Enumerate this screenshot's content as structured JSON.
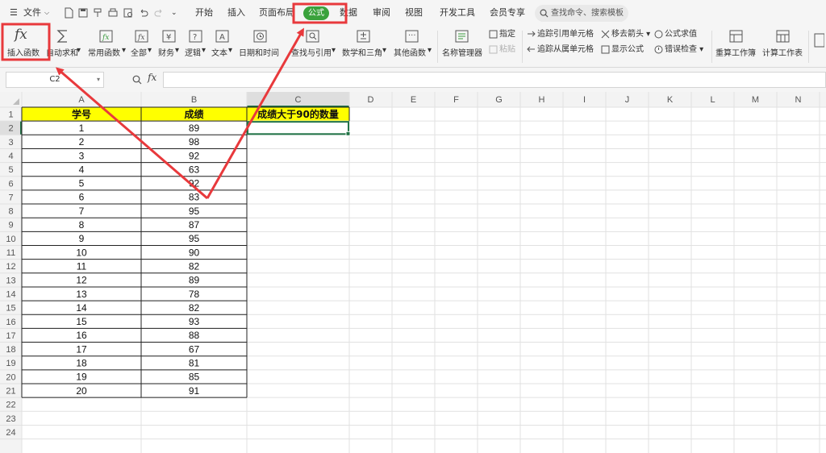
{
  "menu": {
    "file_label": "文件",
    "tabs": [
      "开始",
      "插入",
      "页面布局",
      "公式",
      "数据",
      "审阅",
      "视图",
      "开发工具",
      "会员专享"
    ],
    "active_tab": "公式",
    "search_placeholder": "查找命令、搜索模板"
  },
  "ribbon": {
    "insert_function": "插入函数",
    "autosum": "自动求和",
    "common_functions": "常用函数",
    "all": "全部",
    "financial": "财务",
    "logical": "逻辑",
    "text": "文本",
    "datetime": "日期和时间",
    "lookup": "查找与引用",
    "math": "数学和三角",
    "other": "其他函数",
    "name_manager": "名称管理器",
    "define": "指定",
    "paste": "粘贴",
    "trace_precedents": "追踪引用单元格",
    "trace_dependents": "追踪从属单元格",
    "remove_arrows": "移去箭头",
    "show_formulas": "显示公式",
    "evaluate_formula": "公式求值",
    "error_check": "错误检查",
    "recalc_workbook": "重算工作簿",
    "calc_sheet": "计算工作表",
    "fx_glyph": "fx"
  },
  "formula_bar": {
    "name_box": "C2",
    "fx_label": "fx",
    "formula": ""
  },
  "sheet": {
    "columns": [
      "A",
      "B",
      "C",
      "D",
      "E",
      "F",
      "G",
      "H",
      "I",
      "J",
      "K",
      "L",
      "M",
      "N"
    ],
    "row_numbers": [
      "1",
      "2",
      "3",
      "4",
      "5",
      "6",
      "7",
      "8",
      "9",
      "10",
      "11",
      "12",
      "13",
      "14",
      "15",
      "16",
      "17",
      "18",
      "19",
      "20",
      "21",
      "22",
      "23",
      "24"
    ],
    "headers": [
      "学号",
      "成绩",
      "成绩大于90的数量"
    ],
    "header_bg": "#ffff00",
    "selected_cell": "C2",
    "accent": "#217346",
    "rows": [
      [
        "1",
        "89"
      ],
      [
        "2",
        "98"
      ],
      [
        "3",
        "92"
      ],
      [
        "4",
        "63"
      ],
      [
        "5",
        "92"
      ],
      [
        "6",
        "83"
      ],
      [
        "7",
        "95"
      ],
      [
        "8",
        "87"
      ],
      [
        "9",
        "95"
      ],
      [
        "10",
        "90"
      ],
      [
        "11",
        "82"
      ],
      [
        "12",
        "89"
      ],
      [
        "13",
        "78"
      ],
      [
        "14",
        "82"
      ],
      [
        "15",
        "93"
      ],
      [
        "16",
        "88"
      ],
      [
        "17",
        "67"
      ],
      [
        "18",
        "81"
      ],
      [
        "19",
        "85"
      ],
      [
        "20",
        "91"
      ]
    ]
  },
  "annotation_color": "#e8393c"
}
